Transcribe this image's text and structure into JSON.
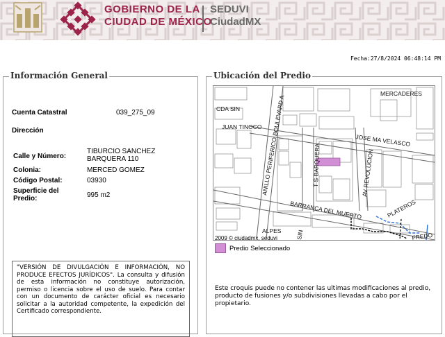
{
  "header": {
    "gov_line1": "GOBIERNO DE LA",
    "gov_line2": "CIUDAD DE MÉXICO",
    "brand_line1": "SEDUVI",
    "brand_line2": "CiudadMX",
    "seal_icon": "cdmx-seal-icon",
    "mark_icon": "cdmx-lattice-logo-icon",
    "accent": "#9d2449"
  },
  "fecha": "Fecha:27/8/2024 06:48:14 PM",
  "info": {
    "title": "Información General",
    "cuenta_label": "Cuenta Catastral",
    "cuenta_value": "039_275_09",
    "direccion_label": "Dirección",
    "calle_label": "Calle y Número:",
    "calle_value_1": "TIBURCIO SANCHEZ",
    "calle_value_2": "BARQUERA 110",
    "colonia_label": "Colonia:",
    "colonia_value": "MERCED GOMEZ",
    "cp_label": "Código Postal:",
    "cp_value": "03930",
    "superficie_label_1": "Superficie del",
    "superficie_label_2": "Predio:",
    "superficie_value": "995 m2",
    "disclaimer": "\"VERSIÓN DE DIVULGACIÓN E INFORMACIÓN, NO PRODUCE EFECTOS JURÍDICOS\". La consulta y difusión de esta información no constituye autorización, permiso o licencia sobre el uso de suelo. Para contar con un documento de carácter oficial es necesario solicitar a la autoridad competente, la expedición del Certificado correspondiente."
  },
  "ubicacion": {
    "title": "Ubicación del Predio",
    "streets": {
      "mercaderes": "MERCADERES",
      "cda_sin": "CDA SIN",
      "juan_tinoco": "JUAN TINOCO",
      "boulevard": "ANILLO PERIFERICO BOULEVARD A",
      "ts_barquera": "T S BARQUERA",
      "jose_ma_velasco": "JOSE MA VELASCO",
      "av_revolucion": "AV REVOLUCION",
      "barranca": "BARRANCA DEL MUERTO",
      "plateros": "PLATEROS",
      "alpes": "ALPES",
      "sin": "SIN",
      "fredo": "FREDO"
    },
    "copyright": "2009 © ciudadmx, seduvi",
    "legend_label": "Predio Seleccionado",
    "highlight_color": "#d38fd6",
    "croquis_note": "Este croquis puede no contener las ultimas modificaciones al predio, producto de fusiones y/o subdivisiones llevadas a cabo por el propietario."
  }
}
